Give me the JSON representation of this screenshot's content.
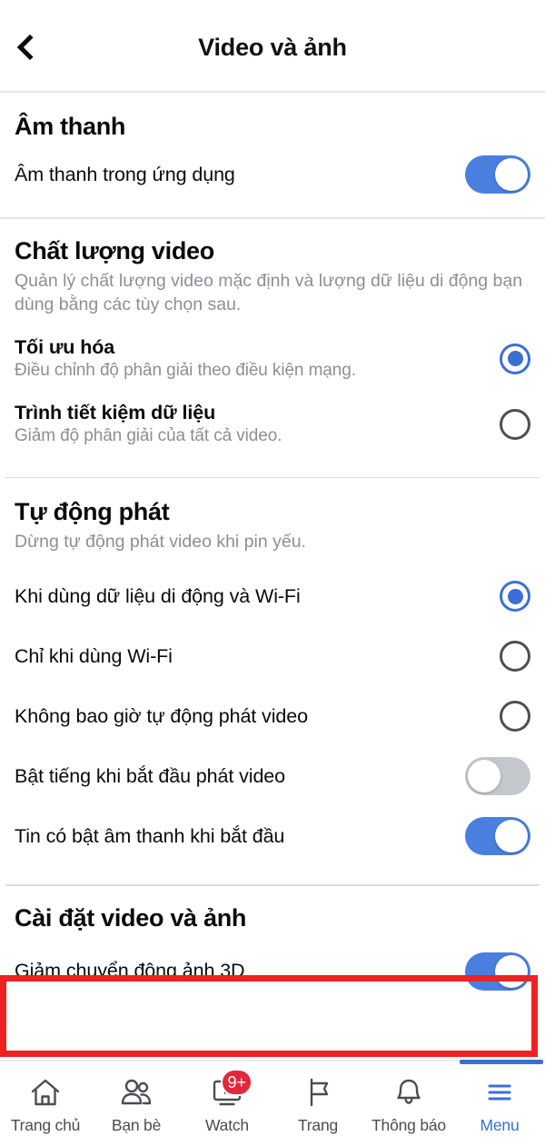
{
  "header": {
    "title": "Video và ảnh",
    "back_icon": "chevron-left-icon"
  },
  "sections": {
    "sound": {
      "title": "Âm thanh",
      "rows": [
        {
          "label": "Âm thanh trong ứng dụng",
          "control": "toggle",
          "state": "on"
        }
      ]
    },
    "video_quality": {
      "title": "Chất lượng video",
      "description": "Quản lý chất lượng video mặc định và lượng dữ liệu di động bạn dùng bằng các tùy chọn sau.",
      "options": [
        {
          "label": "Tối ưu hóa",
          "sub": "Điều chỉnh độ phân giải theo điều kiện mạng.",
          "selected": true
        },
        {
          "label": "Trình tiết kiệm dữ liệu",
          "sub": "Giảm độ phân giải của tất cả video.",
          "selected": false
        }
      ]
    },
    "autoplay": {
      "title": "Tự động phát",
      "description": "Dừng tự động phát video khi pin yếu.",
      "options": [
        {
          "label": "Khi dùng dữ liệu di động và Wi-Fi",
          "selected": true
        },
        {
          "label": "Chỉ khi dùng Wi-Fi",
          "selected": false
        },
        {
          "label": "Không bao giờ tự động phát video",
          "selected": false
        }
      ],
      "toggles": [
        {
          "label": "Bật tiếng khi bắt đầu phát video",
          "state": "off"
        },
        {
          "label": "Tin có bật âm thanh khi bắt đầu",
          "state": "on"
        }
      ]
    },
    "media_settings": {
      "title": "Cài đặt video và ảnh",
      "rows": [
        {
          "label": "Giảm chuyển động ảnh 3D",
          "control": "toggle",
          "state": "on",
          "highlighted": true
        }
      ]
    }
  },
  "bottom_nav": {
    "items": [
      {
        "label": "Trang chủ",
        "icon": "home-icon",
        "active": false,
        "badge": ""
      },
      {
        "label": "Bạn bè",
        "icon": "friends-icon",
        "active": false,
        "badge": ""
      },
      {
        "label": "Watch",
        "icon": "watch-icon",
        "active": false,
        "badge": "9+"
      },
      {
        "label": "Trang",
        "icon": "pages-flag-icon",
        "active": false,
        "badge": ""
      },
      {
        "label": "Thông báo",
        "icon": "bell-icon",
        "active": false,
        "badge": ""
      },
      {
        "label": "Menu",
        "icon": "hamburger-menu-icon",
        "active": true,
        "badge": ""
      }
    ]
  },
  "colors": {
    "accent_blue": "#3b6fd4",
    "toggle_on": "#4a7fe0",
    "toggle_off": "#c4c7cc",
    "highlight_red": "#ee2222",
    "badge_red": "#e4273a",
    "muted_text": "#8b8f96"
  }
}
